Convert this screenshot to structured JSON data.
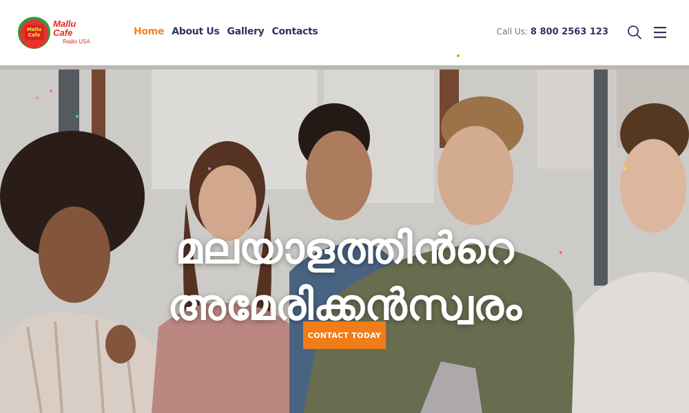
{
  "brand": {
    "name": "Mallu Cafe",
    "subname": "Radio USA",
    "badge_text": "Mallu Cafe",
    "colors": {
      "accent": "#f0861a",
      "navy": "#2c3560",
      "logo_red": "#e0281f",
      "logo_green": "#2e9d3b"
    }
  },
  "nav": {
    "items": [
      {
        "label": "Home",
        "active": true
      },
      {
        "label": "About Us",
        "active": false
      },
      {
        "label": "Gallery",
        "active": false
      },
      {
        "label": "Contacts",
        "active": false
      }
    ]
  },
  "contact": {
    "label": "Call Us:",
    "phone": "8 800 2563 123"
  },
  "icons": {
    "search": "search-icon",
    "menu": "hamburger-menu-icon"
  },
  "hero": {
    "title_line1": "മലയാളത്തിൻറെ",
    "title_line2": "അമേരിക്കൻസ്വരം",
    "cta_label": "CONTACT TODAY",
    "cta_color": "#f07d18"
  }
}
